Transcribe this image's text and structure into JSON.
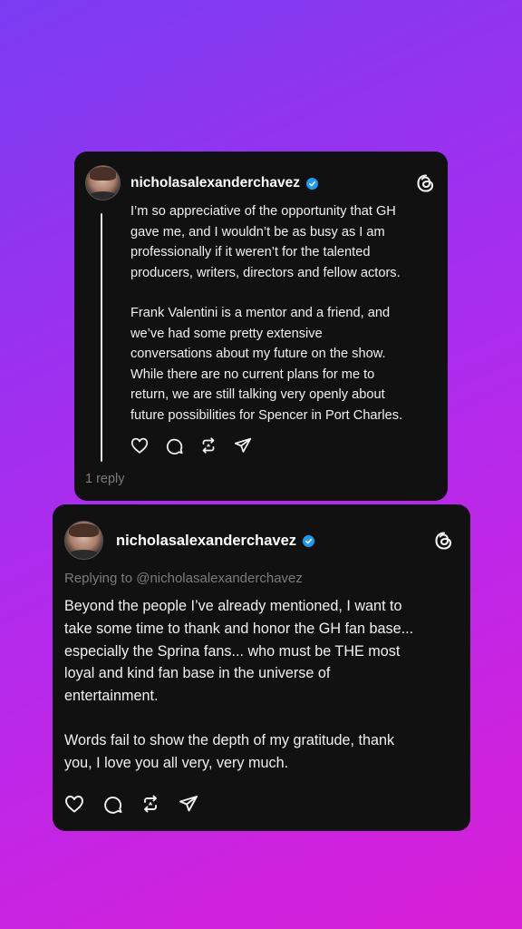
{
  "post1": {
    "username": "nicholasalexanderchavez",
    "paragraph1": "I’m so appreciative of the opportunity that GH\ngave me, and I wouldn’t be as busy as I am\nprofessionally if it weren’t for the talented\nproducers, writers, directors and fellow actors.",
    "paragraph2": " Frank Valentini is a mentor and a friend, and\nwe’ve had some pretty extensive\nconversations about my future on the show.\nWhile there are no current plans for me to\nreturn, we are still talking very openly about\nfuture possibilities for Spencer in Port Charles.",
    "reply_count": "1 reply",
    "icons": [
      "heart-icon",
      "comment-icon",
      "repost-icon",
      "share-icon"
    ]
  },
  "post2": {
    "username": "nicholasalexanderchavez",
    "replying_to": "Replying to @nicholasalexanderchavez",
    "paragraph1": "Beyond the people I’ve already mentioned, I want to\ntake some time to thank and honor the GH fan base...\nespecially the Sprina fans... who must be THE most\nloyal and kind fan base in the universe of\nentertainment.",
    "paragraph2": "Words fail to show the depth of my gratitude, thank\nyou, I love you all very, very much.",
    "icons": [
      "heart-icon",
      "comment-icon",
      "repost-icon",
      "share-icon"
    ]
  },
  "colors": {
    "card_background": "#111111",
    "verified_badge": "#1d9bf0",
    "secondary_text": "#7b7b7b",
    "gradient_start": "#7a3cf2",
    "gradient_end": "#d81fd6"
  }
}
